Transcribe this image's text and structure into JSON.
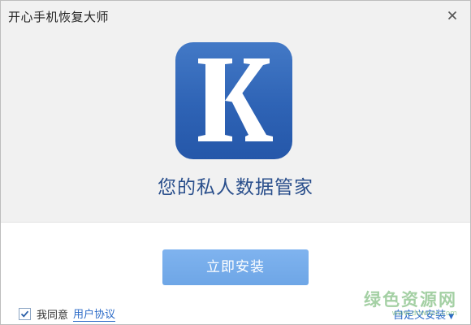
{
  "window": {
    "title": "开心手机恢复大师"
  },
  "icons": {
    "close": "close-icon",
    "logo": "app-logo-k",
    "check": "checkmark-icon",
    "dropdown": "triangle-down-icon"
  },
  "hero": {
    "logo_letter": "K",
    "tagline": "您的私人数据管家"
  },
  "actions": {
    "install_label": "立即安装",
    "agree_label": "我同意",
    "agree_checked": true,
    "agreement_link": "用户协议",
    "custom_install_label": "自定义安装",
    "custom_install_arrow": "▼"
  },
  "watermark": {
    "text": "绿色资源网",
    "url": "www.downcc.com"
  },
  "colors": {
    "logo_bg": "#2e63b5",
    "tagline": "#2a4f8c",
    "install_button": "#72a9e8",
    "link": "#2c6bc7",
    "watermark": "#5aaa5a"
  }
}
